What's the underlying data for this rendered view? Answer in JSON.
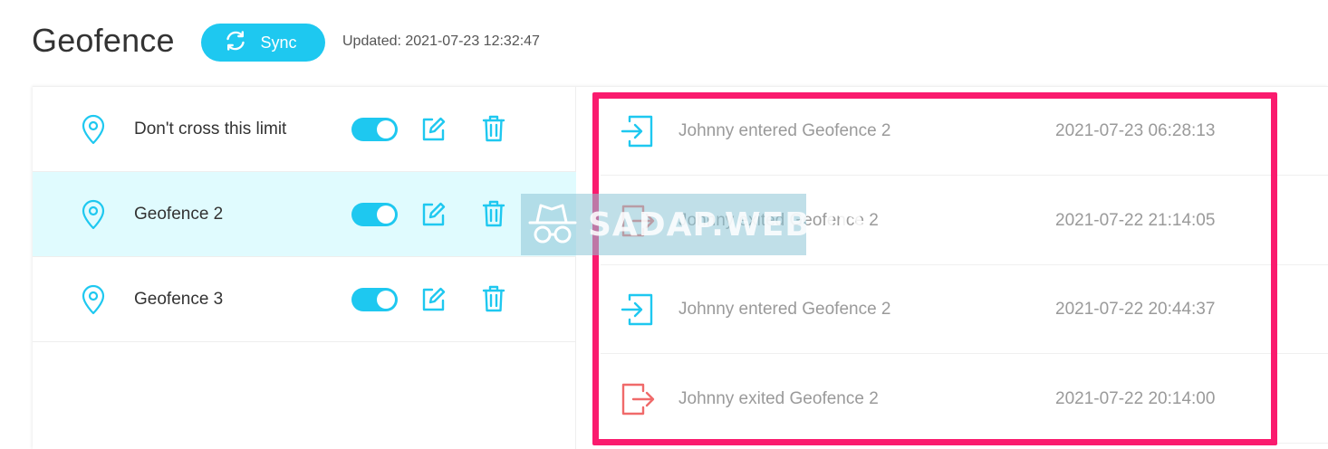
{
  "header": {
    "title": "Geofence",
    "sync_label": "Sync",
    "updated": "Updated: 2021-07-23 12:32:47"
  },
  "geofences": [
    {
      "name": "Don't cross this limit",
      "enabled": true,
      "selected": false
    },
    {
      "name": "Geofence 2",
      "enabled": true,
      "selected": true
    },
    {
      "name": "Geofence 3",
      "enabled": true,
      "selected": false
    }
  ],
  "events": [
    {
      "type": "entered",
      "text": "Johnny entered Geofence 2",
      "time": "2021-07-23 06:28:13"
    },
    {
      "type": "exited",
      "text": "Johnny exited Geofence 2",
      "time": "2021-07-22 21:14:05"
    },
    {
      "type": "entered",
      "text": "Johnny entered Geofence 2",
      "time": "2021-07-22 20:44:37"
    },
    {
      "type": "exited",
      "text": "Johnny exited Geofence 2",
      "time": "2021-07-22 20:14:00"
    }
  ],
  "watermark": "SADAP.WEB.ID",
  "colors": {
    "accent": "#1ec8f0",
    "selected_row": "#e0fbfe",
    "exit": "#f06a6a",
    "highlight": "#fa1b6e"
  },
  "icons": {
    "sync": "sync-icon",
    "pin": "location-pin-icon",
    "edit": "edit-icon",
    "delete": "trash-icon",
    "enter": "enter-icon",
    "exit": "exit-icon"
  }
}
